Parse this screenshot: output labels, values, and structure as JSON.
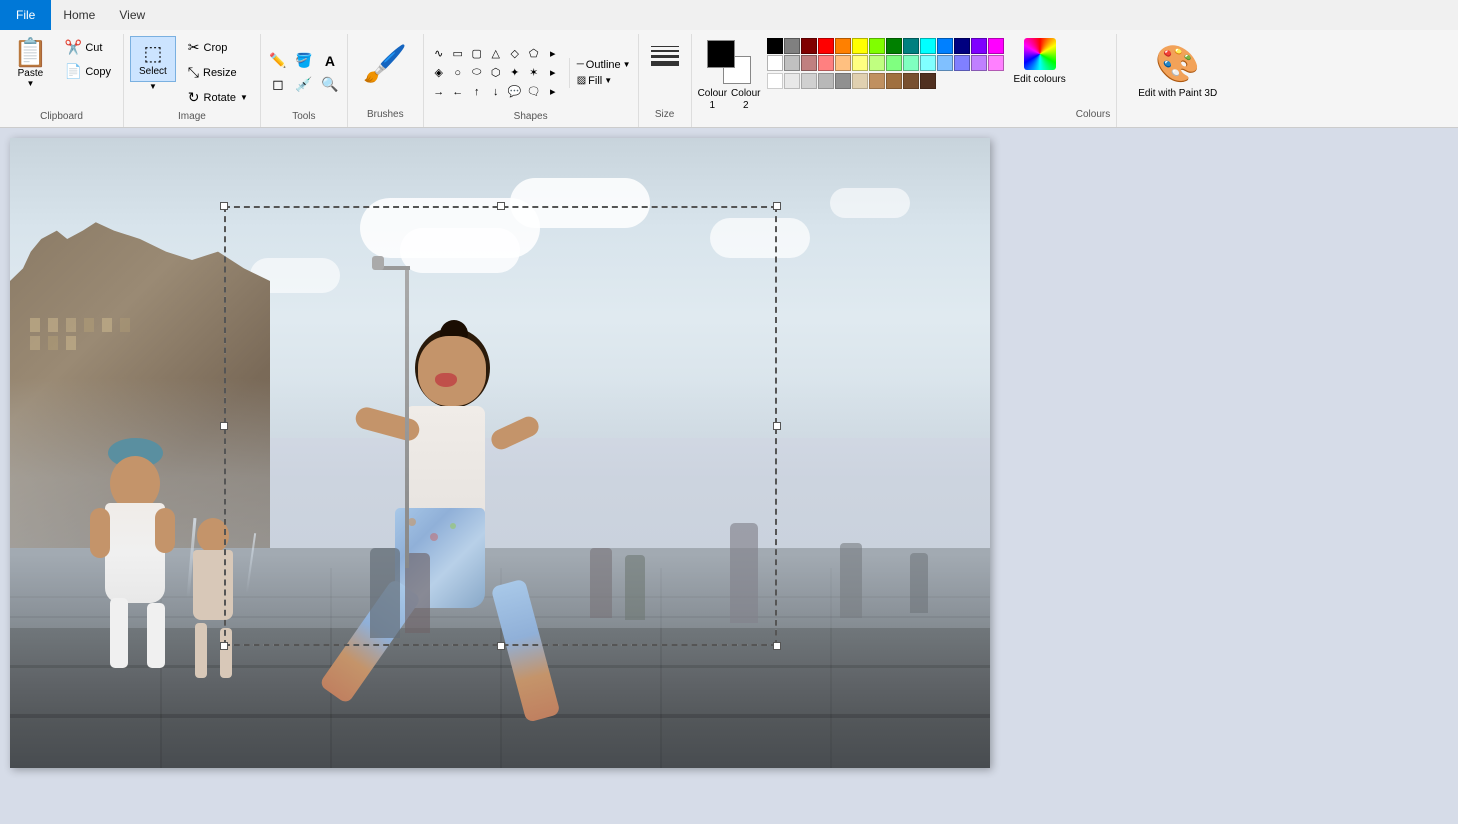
{
  "menu": {
    "file_label": "File",
    "home_label": "Home",
    "view_label": "View"
  },
  "ribbon": {
    "clipboard": {
      "label": "Clipboard",
      "paste_label": "Paste",
      "cut_label": "Cut",
      "copy_label": "Copy"
    },
    "image": {
      "label": "Image",
      "crop_label": "Crop",
      "resize_label": "Resize",
      "rotate_label": "Rotate",
      "select_label": "Select"
    },
    "tools": {
      "label": "Tools"
    },
    "brushes": {
      "label": "Brushes"
    },
    "shapes": {
      "label": "Shapes",
      "outline_label": "Outline",
      "fill_label": "Fill"
    },
    "size": {
      "label": "Size"
    },
    "colours": {
      "label": "Colours",
      "colour1_label": "Colour\n1",
      "colour2_label": "Colour\n2",
      "edit_colours_label": "Edit\ncolours"
    },
    "paint3d": {
      "label": "Edit with\nPaint 3D"
    }
  },
  "colours": {
    "row1": [
      "#000000",
      "#808080",
      "#800000",
      "#ff0000",
      "#ff8040",
      "#ffff00",
      "#80ff00",
      "#00ff00",
      "#00ff80",
      "#00ffff",
      "#0080ff",
      "#0000ff",
      "#8000ff",
      "#ff00ff"
    ],
    "row2": [
      "#ffffff",
      "#c0c0c0",
      "#804040",
      "#ff8080",
      "#ffc080",
      "#ffff80",
      "#c0ff80",
      "#80ff80",
      "#80ffc0",
      "#80ffff",
      "#80c0ff",
      "#8080ff",
      "#c080ff",
      "#ff80ff"
    ],
    "extra": [
      "#ffffff",
      "#e0e0e0",
      "#c0c0c0",
      "#a0a0a0",
      "#606060",
      "#e0d0c0",
      "#c09060",
      "#a07040",
      "#785030",
      "#503020"
    ]
  }
}
